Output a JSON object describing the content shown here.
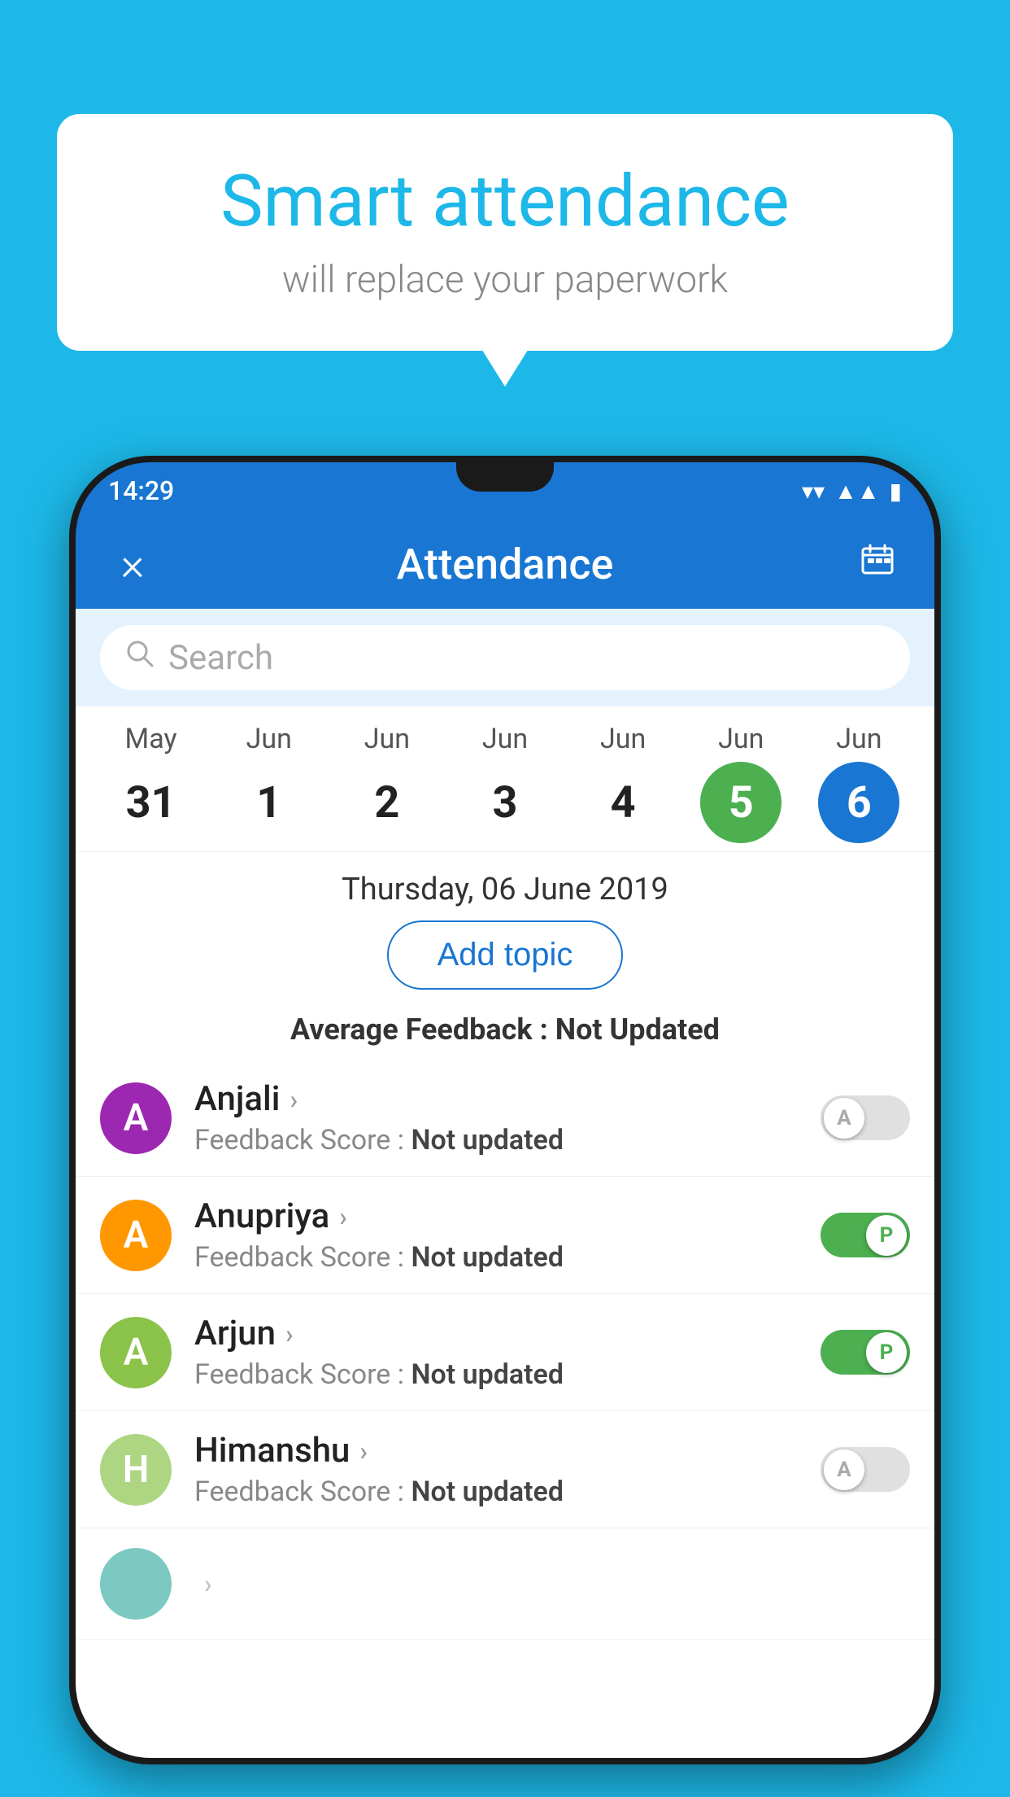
{
  "background_color": "#1DB8E8",
  "bubble": {
    "title": "Smart attendance",
    "subtitle": "will replace your paperwork"
  },
  "status_bar": {
    "time": "14:29",
    "wifi": "▼",
    "signal": "▲",
    "battery": "▮"
  },
  "app_bar": {
    "title": "Attendance",
    "close_icon": "×",
    "calendar_icon": "📅"
  },
  "search": {
    "placeholder": "Search"
  },
  "calendar": {
    "months": [
      "May",
      "Jun",
      "Jun",
      "Jun",
      "Jun",
      "Jun",
      "Jun"
    ],
    "days": [
      "31",
      "1",
      "2",
      "3",
      "4",
      "5",
      "6"
    ],
    "today_index": 5,
    "selected_index": 6
  },
  "selected_date": "Thursday, 06 June 2019",
  "add_topic_label": "Add topic",
  "avg_feedback": {
    "label": "Average Feedback : ",
    "value": "Not Updated"
  },
  "students": [
    {
      "name": "Anjali",
      "avatar_letter": "A",
      "avatar_color": "purple",
      "feedback": "Not updated",
      "attendance": "A",
      "present": false
    },
    {
      "name": "Anupriya",
      "avatar_letter": "A",
      "avatar_color": "orange",
      "feedback": "Not updated",
      "attendance": "P",
      "present": true
    },
    {
      "name": "Arjun",
      "avatar_letter": "A",
      "avatar_color": "light-green",
      "feedback": "Not updated",
      "attendance": "P",
      "present": true
    },
    {
      "name": "Himanshu",
      "avatar_letter": "H",
      "avatar_color": "light-green2",
      "feedback": "Not updated",
      "attendance": "A",
      "present": false
    }
  ]
}
